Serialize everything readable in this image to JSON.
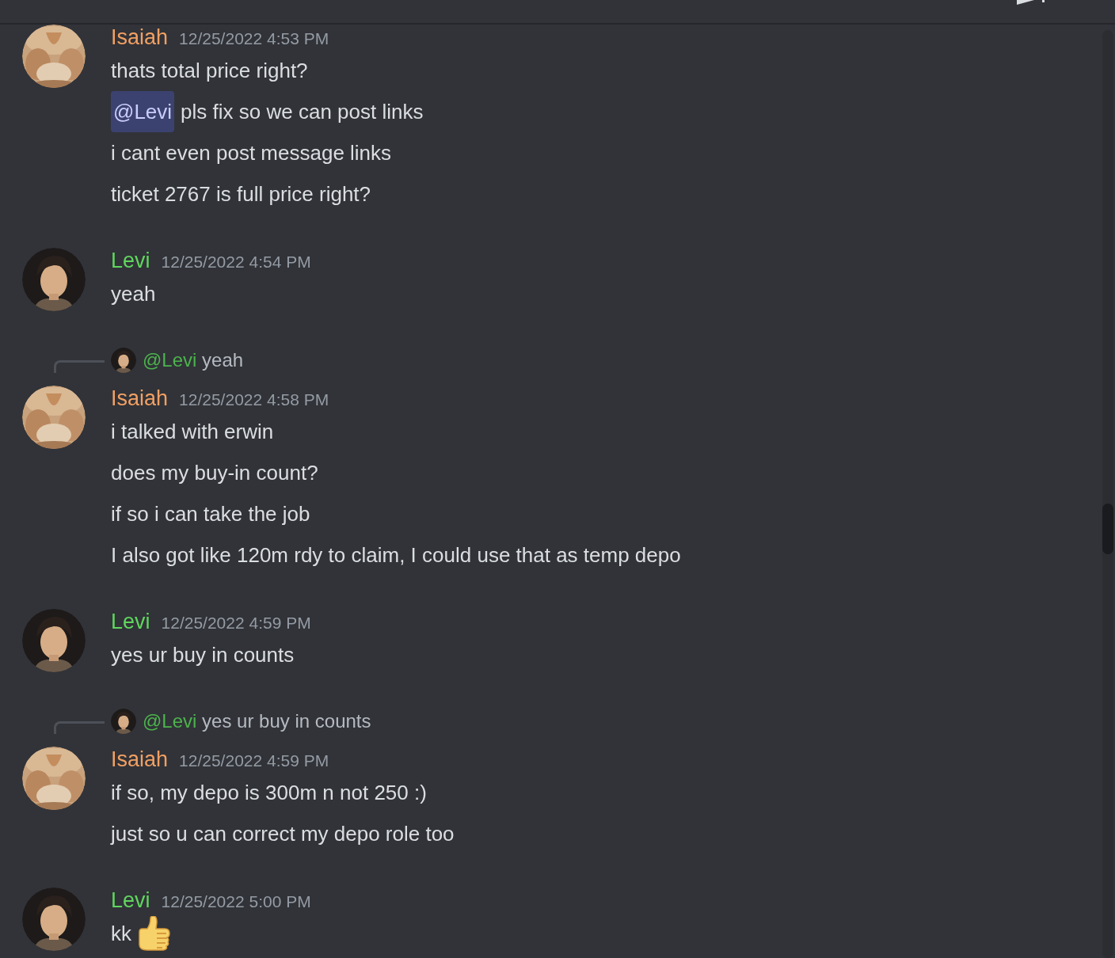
{
  "messages": [
    {
      "author": "Isaiah",
      "color": "#f2a063",
      "timestamp": "12/25/2022 4:53 PM",
      "lines": [
        {
          "text": "thats total price right?"
        },
        {
          "mention": "@Levi",
          "text": "pls fix so we can post links"
        },
        {
          "text": "i cant even post message links"
        },
        {
          "text": "ticket 2767 is full price right?"
        }
      ]
    },
    {
      "author": "Levi",
      "color": "#60d65e",
      "timestamp": "12/25/2022 4:54 PM",
      "lines": [
        {
          "text": "yeah"
        }
      ]
    },
    {
      "author": "Isaiah",
      "color": "#f2a063",
      "timestamp": "12/25/2022 4:58 PM",
      "reply": {
        "mention": "@Levi",
        "color": "#4cb34c",
        "text": "yeah"
      },
      "lines": [
        {
          "text": "i talked with erwin"
        },
        {
          "text": "does my buy-in count?"
        },
        {
          "text": "if so i can take the job"
        },
        {
          "text": "I also got like 120m rdy to claim, I could use that as temp depo"
        }
      ]
    },
    {
      "author": "Levi",
      "color": "#60d65e",
      "timestamp": "12/25/2022 4:59 PM",
      "lines": [
        {
          "text": "yes ur buy in counts"
        }
      ]
    },
    {
      "author": "Isaiah",
      "color": "#f2a063",
      "timestamp": "12/25/2022 4:59 PM",
      "reply": {
        "mention": "@Levi",
        "color": "#4cb34c",
        "text": "yes ur buy in counts"
      },
      "lines": [
        {
          "text": "if so, my depo is 300m n not 250 :)"
        },
        {
          "text": "just so u can correct my depo role too"
        }
      ]
    },
    {
      "author": "Levi",
      "color": "#60d65e",
      "timestamp": "12/25/2022 5:00 PM",
      "lines": [
        {
          "text": "kk",
          "thumbs_up": true
        }
      ]
    }
  ]
}
